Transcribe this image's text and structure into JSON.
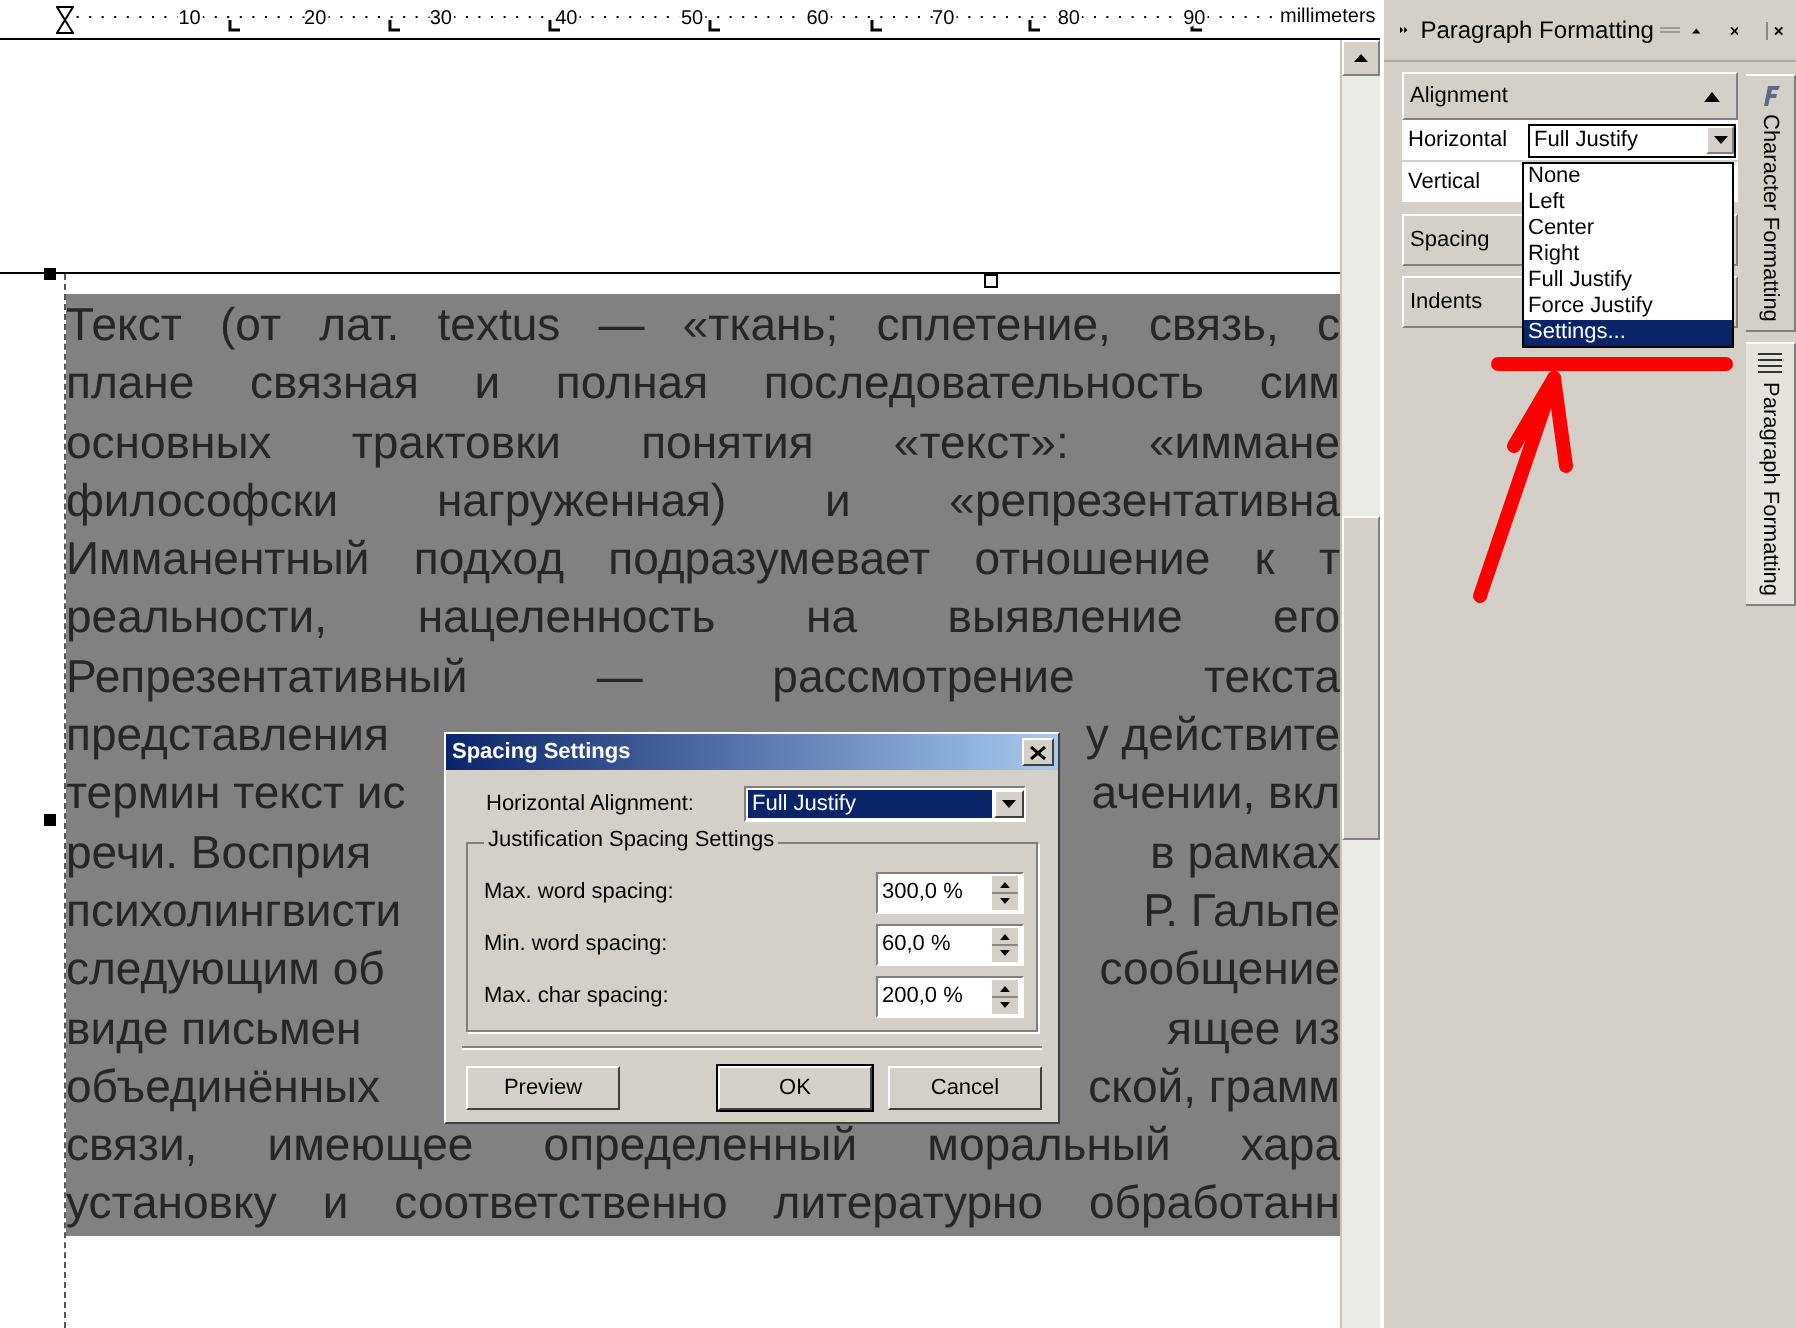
{
  "ruler": {
    "numbers": [
      "10",
      "20",
      "30",
      "40",
      "50",
      "60",
      "70",
      "80",
      "90"
    ],
    "unit": "millimeters"
  },
  "document": {
    "lines": [
      {
        "segments": [
          "Текст (от лат. textus — «ткань; сплетение, связь, с"
        ]
      },
      {
        "segments": [
          "плане связная и полная последовательность сим"
        ]
      },
      {
        "segments": [
          "основных трактовки понятия «текст»: «иммане"
        ]
      },
      {
        "segments": [
          "философски нагруженная) и «репрезентативна"
        ]
      },
      {
        "segments": [
          "Имманентный подход подразумевает отношение к т"
        ]
      },
      {
        "segments": [
          "реальности, нацеленность на выявление его"
        ]
      },
      {
        "segments": [
          "Репрезентативный — рассмотрение текста"
        ]
      },
      {
        "segments": [
          "представления",
          "у действите"
        ]
      },
      {
        "segments": [
          "термин текст ис",
          "ачении, вкл"
        ]
      },
      {
        "segments": [
          "речи. Восприя",
          "в рамках"
        ]
      },
      {
        "segments": [
          "психолингвисти",
          "Р. Гальпе"
        ]
      },
      {
        "segments": [
          "следующим об",
          "сообщение"
        ]
      },
      {
        "segments": [
          "виде письмен",
          "ящее из"
        ]
      },
      {
        "segments": [
          "объединённых",
          "ской, грамм"
        ]
      },
      {
        "segments": [
          "связи, имеющее определенный моральный хара"
        ]
      },
      {
        "segments": [
          "установку и соответственно литературно обработанн"
        ]
      }
    ]
  },
  "panel": {
    "title": "Paragraph Formatting",
    "sections": [
      {
        "label": "Alignment",
        "expanded": true,
        "rows": [
          {
            "label": "Horizontal",
            "value": "Full Justify"
          },
          {
            "label": "Vertical"
          }
        ]
      },
      {
        "label": "Spacing",
        "expanded": false
      },
      {
        "label": "Indents",
        "expanded": false
      }
    ],
    "dropdown_options": [
      {
        "label": "None",
        "selected": false
      },
      {
        "label": "Left",
        "selected": false
      },
      {
        "label": "Center",
        "selected": false
      },
      {
        "label": "Right",
        "selected": false
      },
      {
        "label": "Full Justify",
        "selected": false
      },
      {
        "label": "Force Justify",
        "selected": false
      },
      {
        "label": "Settings...",
        "selected": true
      }
    ],
    "side_tabs": [
      {
        "label": "Character Formatting",
        "selected": false
      },
      {
        "label": "Paragraph Formatting",
        "selected": true
      }
    ]
  },
  "dialog": {
    "title": "Spacing Settings",
    "alignment": {
      "label": "Horizontal Alignment:",
      "value": "Full Justify"
    },
    "group": {
      "title": "Justification Spacing Settings",
      "rows": [
        {
          "label": "Max. word spacing:",
          "value": "300,0 %"
        },
        {
          "label": "Min. word spacing:",
          "value": "60,0 %"
        },
        {
          "label": "Max. char spacing:",
          "value": "200,0 %"
        }
      ]
    },
    "buttons": [
      {
        "label": "Preview",
        "default": false
      },
      {
        "label": "OK",
        "default": true
      },
      {
        "label": "Cancel",
        "default": false
      }
    ]
  }
}
